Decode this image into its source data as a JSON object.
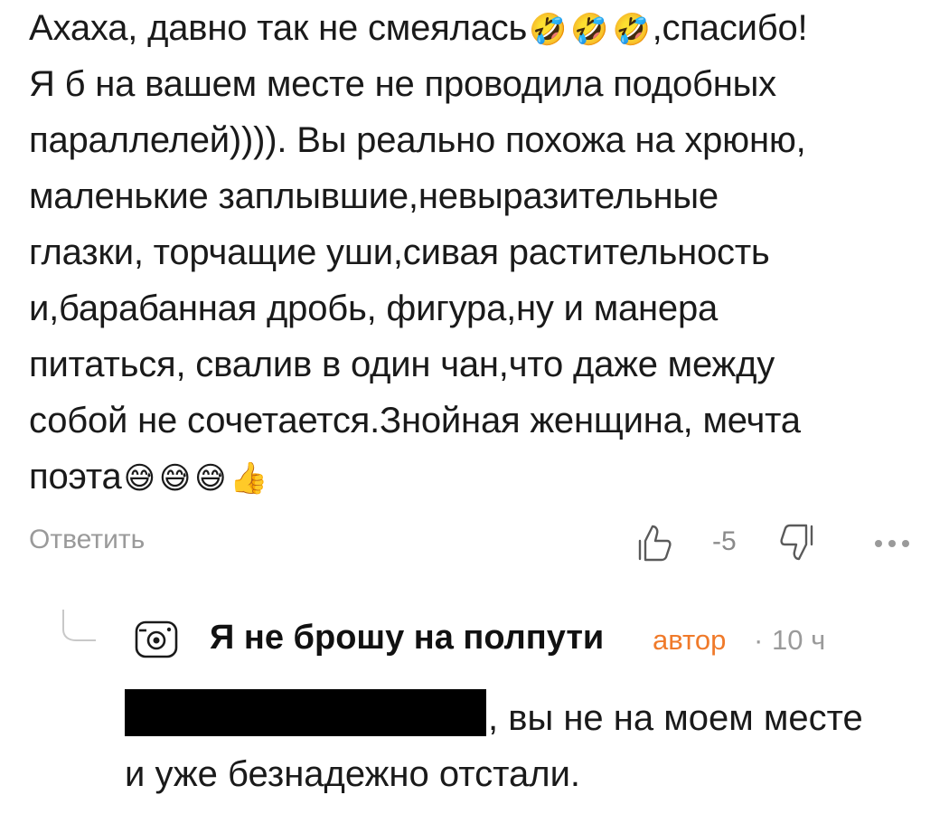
{
  "comment": {
    "lines": [
      {
        "text": "Ахаха, давно так не смеялась",
        "emojis": [
          "🤣",
          "🤣",
          "🤣"
        ],
        "after": ",спасибо!"
      },
      {
        "text": "Я б на вашем месте не проводила подобных"
      },
      {
        "text": "параллелей)))). Вы реально похожа на хрюню,"
      },
      {
        "text": "маленькие заплывшие,невыразительные"
      },
      {
        "text": "глазки, торчащие уши,сивая растительность"
      },
      {
        "text": "и,барабанная дробь, фигура,ну и манера"
      },
      {
        "text": "питаться, свалив в один чан,что даже между"
      },
      {
        "text": "собой не сочетается.Знойная женщина, мечта"
      },
      {
        "text": "поэта",
        "emojis": [
          "😅",
          "😅",
          "😅",
          "👍"
        ]
      }
    ]
  },
  "actions": {
    "reply_label": "Ответить",
    "score": "-5",
    "like_icon": "thumbs-up-outline-icon",
    "dislike_icon": "thumbs-down-outline-icon",
    "more_icon": "more-dots-icon"
  },
  "reply": {
    "avatar_icon": "camera-avatar-icon",
    "author": "Я не брошу на полпути",
    "badge": "автор",
    "separator": "·",
    "time": "10 ч",
    "line1": ", вы не на моем месте",
    "line2": "и уже безнадежно отстали."
  },
  "colors": {
    "text": "#1a1a1a",
    "muted": "#9a9a9a",
    "accent": "#f07a2a",
    "redaction": "#000000"
  }
}
